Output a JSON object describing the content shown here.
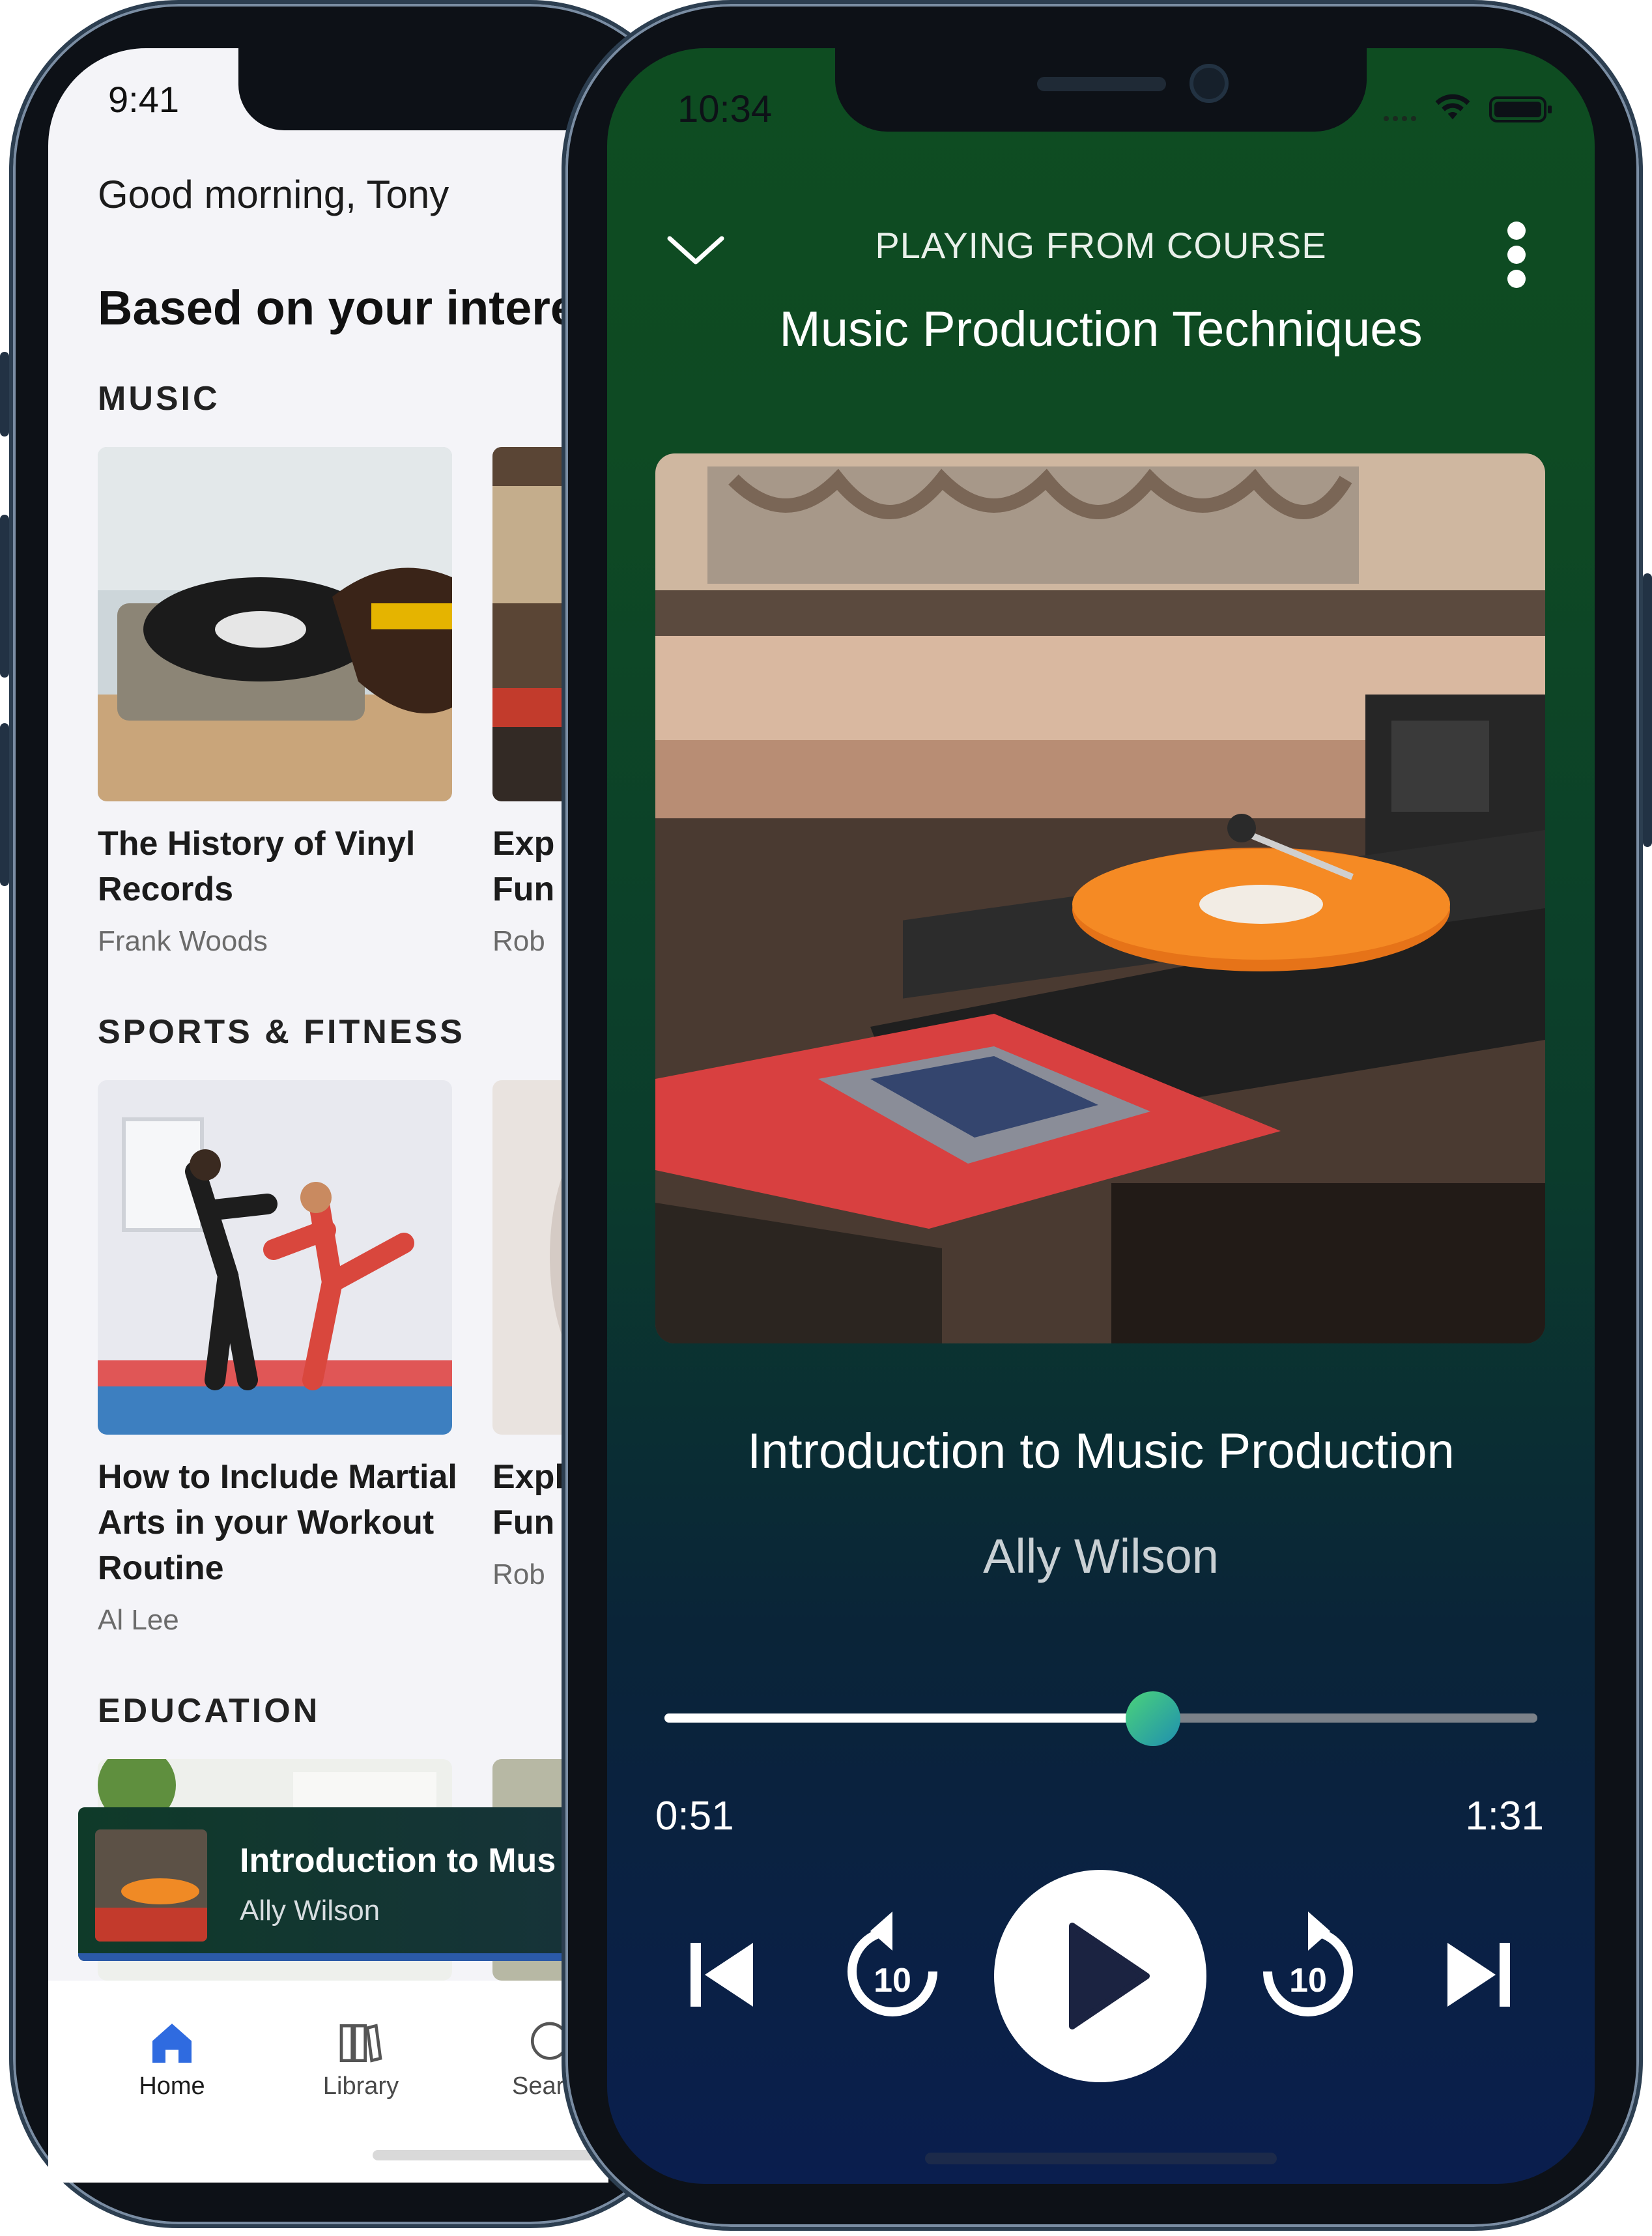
{
  "back_phone": {
    "status_time": "9:41",
    "greeting": "Good morning, Tony",
    "section_heading": "Based on your intere",
    "categories": [
      {
        "label": "MUSIC",
        "cards": [
          {
            "title": "The History of Vinyl Records",
            "author": "Frank Woods"
          },
          {
            "title": "Exp Fun",
            "author": "Rob"
          }
        ]
      },
      {
        "label": "SPORTS & FITNESS",
        "cards": [
          {
            "title": "How to Include Martial Arts in your Workout Routine",
            "author": "Al Lee"
          },
          {
            "title": "Expl Fun",
            "author": "Rob"
          }
        ]
      },
      {
        "label": "EDUCATION",
        "cards": []
      }
    ],
    "mini_player": {
      "title": "Introduction to Mus",
      "author": "Ally Wilson"
    },
    "tabs": [
      {
        "label": "Home",
        "icon": "home-icon",
        "active": true
      },
      {
        "label": "Library",
        "icon": "library-icon",
        "active": false
      },
      {
        "label": "Sear",
        "icon": "search-icon",
        "active": false
      }
    ],
    "colors": {
      "accent": "#2f6be0",
      "background": "#f4f4f8"
    }
  },
  "front_phone": {
    "status_time": "10:34",
    "header": {
      "playing_from": "PLAYING FROM COURSE",
      "course_title": "Music Production Techniques"
    },
    "track": {
      "title": "Introduction to Music Production",
      "artist": "Ally Wilson"
    },
    "progress": {
      "elapsed": "0:51",
      "total": "1:31",
      "fraction": 0.56
    },
    "controls": {
      "rewind_seconds": "10",
      "forward_seconds": "10"
    },
    "icons": [
      "chevron-down-icon",
      "more-vert-icon",
      "skip-previous-icon",
      "replay-10-icon",
      "play-icon",
      "forward-10-icon",
      "skip-next-icon",
      "wifi-icon",
      "battery-icon",
      "signal-icon"
    ],
    "colors": {
      "gradient_top": "#0e4c21",
      "gradient_bottom": "#0a1e4e",
      "thumb": "#3cc88a"
    }
  }
}
